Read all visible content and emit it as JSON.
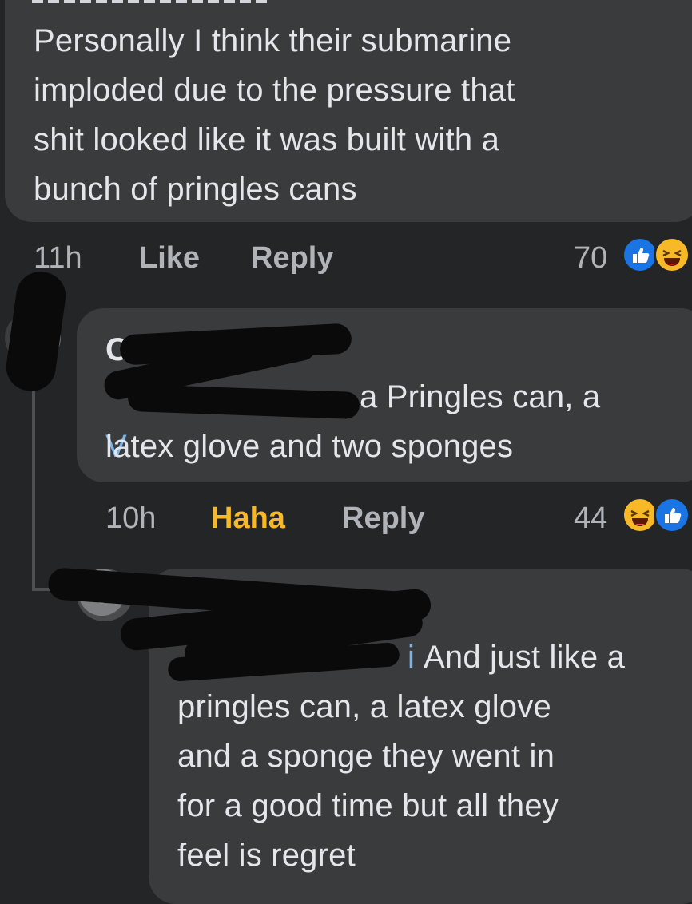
{
  "comments": [
    {
      "author_partial": "",
      "text": "Personally I think their submarine\nimploded due to the pressure that\nshit looked like it was built with a\nbunch of pringles cans",
      "time": "11h",
      "like_label": "Like",
      "reply_label": "Reply",
      "reaction_count": "70",
      "reactions": [
        "like-icon",
        "haha-icon"
      ]
    },
    {
      "author_partial": "C",
      "mention_partial": "V",
      "text_line1": "a Pringles can, a",
      "text_rest": "latex glove and two sponges",
      "time": "10h",
      "haha_label": "Haha",
      "reply_label": "Reply",
      "reaction_count": "44",
      "reactions": [
        "haha-icon",
        "like-icon"
      ]
    },
    {
      "mention_partial": "i",
      "text_line1": "And just like a",
      "text_rest": "pringles can, a latex glove\nand a sponge they went in\nfor a good time but all they\nfeel is regret"
    }
  ],
  "colors": {
    "background": "#242526",
    "bubble": "#3a3b3c",
    "text": "#e4e6eb",
    "secondary_text": "#b0b3b8",
    "mention": "#7ab4e8",
    "haha_active": "#f7b928",
    "like_blue": "#1b74e4"
  }
}
